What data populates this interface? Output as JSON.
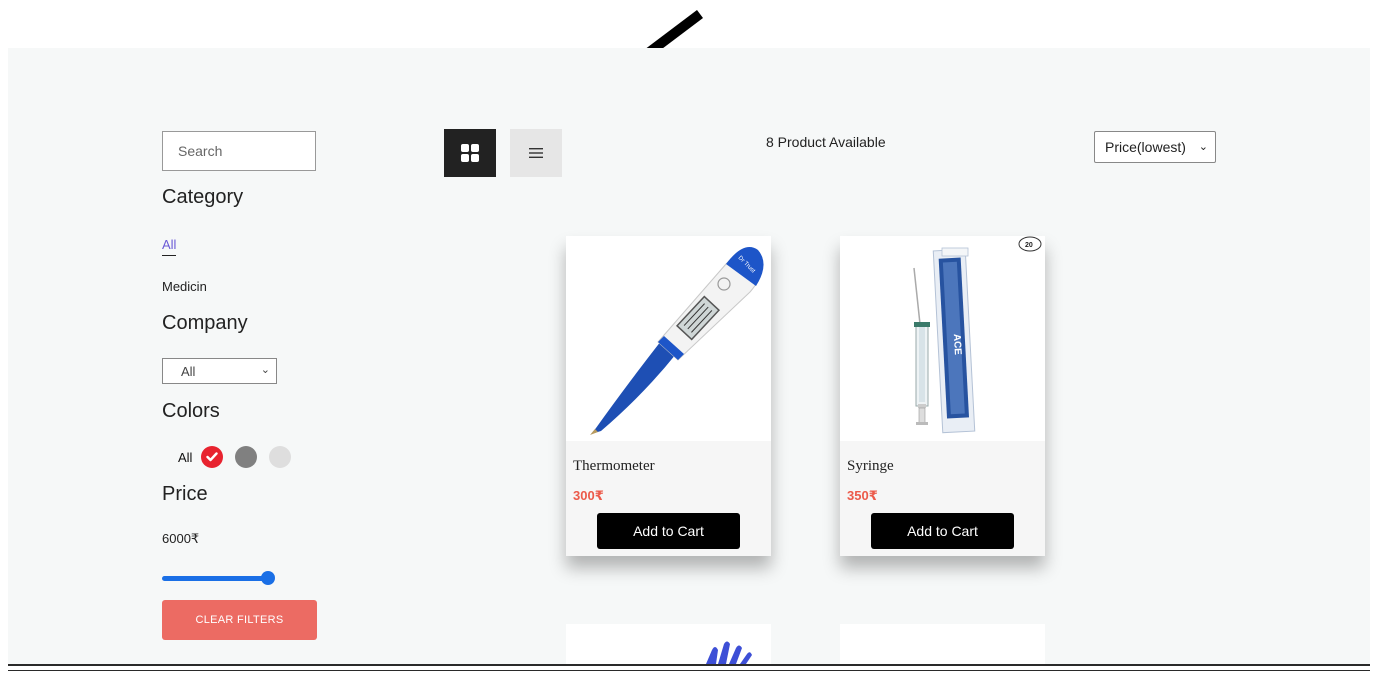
{
  "sidebar": {
    "search_placeholder": "Search",
    "category_heading": "Category",
    "categories": [
      "All",
      "Medicin"
    ],
    "company_heading": "Company",
    "company_selected": "All",
    "colors_heading": "Colors",
    "colors_all_label": "All",
    "colors": [
      "#e8232f",
      "#808080",
      "#dedede"
    ],
    "price_heading": "Price",
    "price_value": "6000₹",
    "price_slider_fraction": 1.0,
    "clear_filters_label": "CLEAR FILTERS"
  },
  "toolbar": {
    "grid_view_icon": "grid-icon",
    "list_view_icon": "list-icon",
    "product_count": "8 Product Available",
    "sort_selected": "Price(lowest)"
  },
  "products": [
    {
      "name": "Thermometer",
      "price": "300₹",
      "cart_label": "Add to Cart",
      "image": "digital-thermometer",
      "badge": "Dr Trust"
    },
    {
      "name": "Syringe",
      "price": "350₹",
      "cart_label": "Add to Cart",
      "image": "syringe-pack",
      "badge": "20",
      "brand": "ACE"
    }
  ],
  "theme": {
    "accent": "#ec6b63",
    "primary_blue": "#1a6fe6",
    "active_link": "#6b5ad6",
    "price_color": "#ec5a4a"
  }
}
